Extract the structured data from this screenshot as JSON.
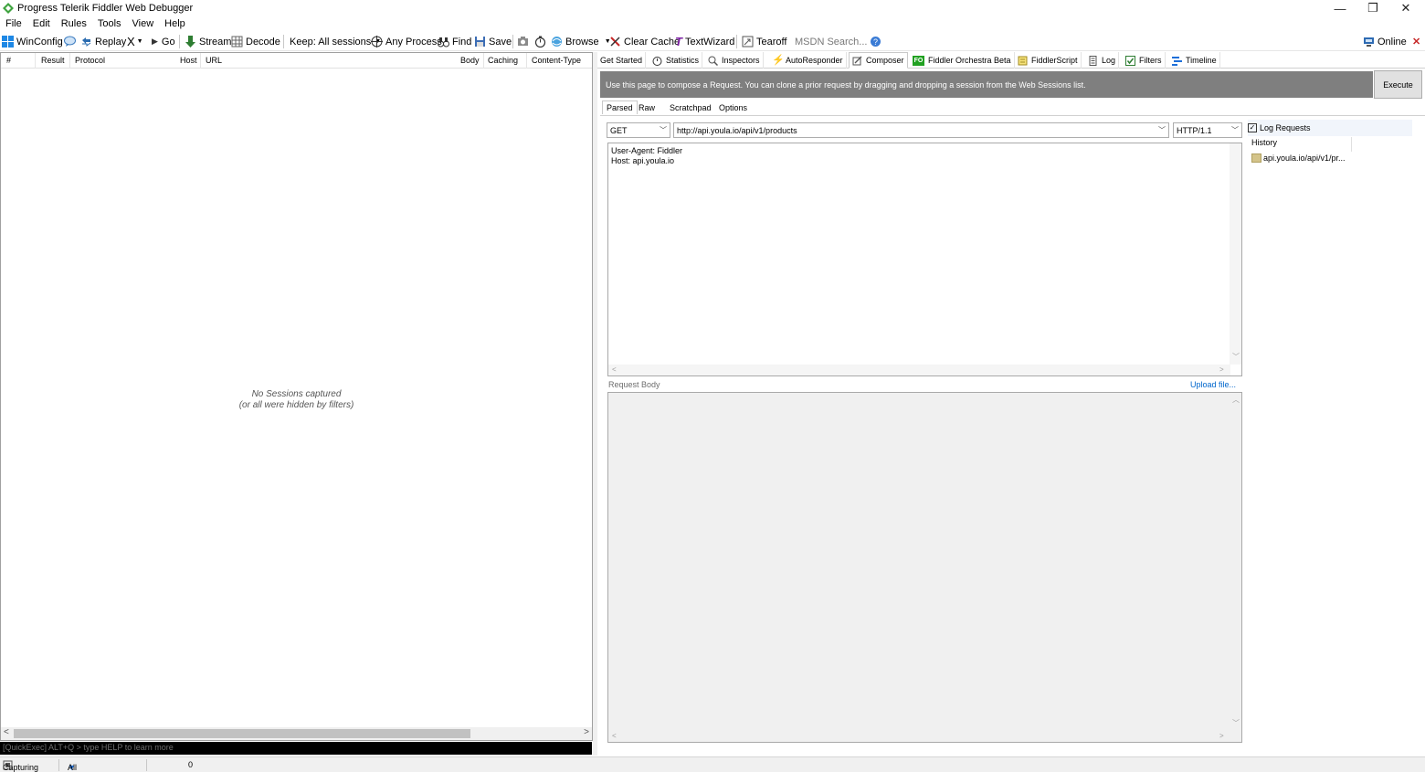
{
  "window": {
    "title": "Progress Telerik Fiddler Web Debugger",
    "minimize": "—",
    "restore": "❐",
    "close": "✕"
  },
  "menu": [
    "File",
    "Edit",
    "Rules",
    "Tools",
    "View",
    "Help"
  ],
  "toolbar": {
    "winconfig": "WinConfig",
    "replay": "Replay",
    "remove": "X",
    "go": "Go",
    "stream": "Stream",
    "decode": "Decode",
    "keep": "Keep: All sessions",
    "process": "Any Process",
    "find": "Find",
    "save": "Save",
    "browse": "Browse",
    "clear_cache": "Clear Cache",
    "textwizard": "TextWizard",
    "tearoff": "Tearoff",
    "msdn": "MSDN Search...",
    "online": "Online"
  },
  "sessions": {
    "columns": [
      "#",
      "Result",
      "Protocol",
      "Host",
      "URL",
      "Body",
      "Caching",
      "Content-Type"
    ],
    "empty_line1": "No Sessions captured",
    "empty_line2": "(or all were hidden by filters)"
  },
  "quickexec": {
    "placeholder": "[QuickExec] ALT+Q > type HELP to learn more"
  },
  "tabs": [
    {
      "label": "Get Started"
    },
    {
      "label": "Statistics"
    },
    {
      "label": "Inspectors"
    },
    {
      "label": "AutoResponder"
    },
    {
      "label": "Composer"
    },
    {
      "label": "Fiddler Orchestra Beta"
    },
    {
      "label": "FiddlerScript"
    },
    {
      "label": "Log"
    },
    {
      "label": "Filters"
    },
    {
      "label": "Timeline"
    }
  ],
  "composer": {
    "banner": "Use this page to compose a Request. You can clone a prior request by dragging and dropping a session from the Web Sessions list.",
    "execute": "Execute",
    "subtabs": [
      "Parsed",
      "Raw",
      "Scratchpad",
      "Options"
    ],
    "method": "GET",
    "url": "http://api.youla.io/api/v1/products",
    "http_version": "HTTP/1.1",
    "headers_line1": "User-Agent: Fiddler",
    "headers_line2": "Host: api.youla.io",
    "request_body_label": "Request Body",
    "upload_file": "Upload file...",
    "log_requests": "Log Requests",
    "log_requests_checked": true,
    "history_label": "History",
    "history_items": [
      "api.youla.io/api/v1/pr..."
    ]
  },
  "status": {
    "capturing": "Capturing",
    "processes": "All Processes",
    "count": "0"
  },
  "colors": {
    "banner_bg": "#7f7f7f",
    "link": "#0066cc",
    "quickexec_bg": "#000000"
  }
}
